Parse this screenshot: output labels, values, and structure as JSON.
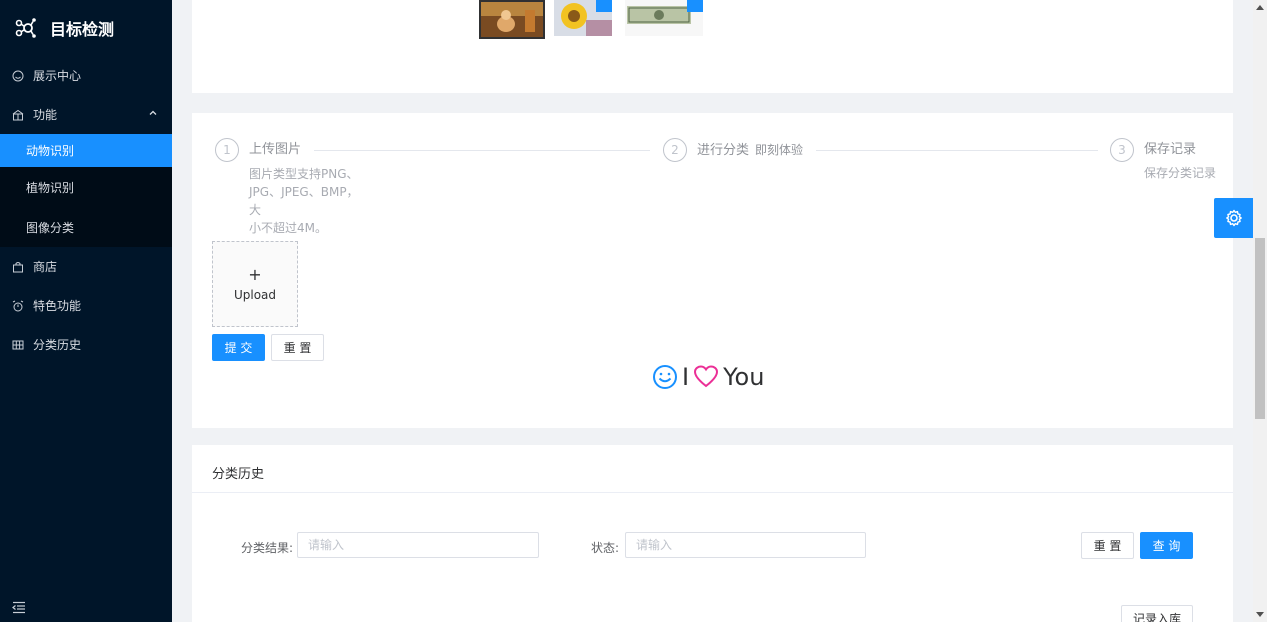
{
  "app": {
    "title": "目标检测"
  },
  "sidebar": {
    "items": [
      {
        "label": "展示中心",
        "icon": "smile-icon"
      },
      {
        "label": "功能",
        "icon": "gift-icon",
        "expanded": true,
        "children": [
          {
            "label": "动物识别",
            "active": true
          },
          {
            "label": "植物识别"
          },
          {
            "label": "图像分类"
          }
        ]
      },
      {
        "label": "商店",
        "icon": "shopping-bag-icon"
      },
      {
        "label": "特色功能",
        "icon": "alarm-icon"
      },
      {
        "label": "分类历史",
        "icon": "grid-icon"
      }
    ]
  },
  "steps": [
    {
      "num": "1",
      "title": "上传图片",
      "desc": [
        "图片类型支持PNG、",
        "JPG、JPEG、BMP，大",
        "小不超过4M。"
      ]
    },
    {
      "num": "2",
      "title": "进行分类",
      "sub": "即刻体验"
    },
    {
      "num": "3",
      "title": "保存记录",
      "desc": [
        "保存分类记录"
      ]
    }
  ],
  "upload": {
    "plus": "+",
    "label": "Upload"
  },
  "buttons": {
    "submit": "提 交",
    "reset": "重 置",
    "query": "查 询",
    "history_reset": "重 置",
    "record": "记录入库"
  },
  "love": {
    "i": "I",
    "you": "You"
  },
  "history": {
    "title": "分类历史",
    "result_label": "分类结果:",
    "result_placeholder": "请输入",
    "status_label": "状态:",
    "status_placeholder": "请输入"
  },
  "colors": {
    "primary": "#1890ff",
    "sidebar_bg": "#001529",
    "heart": "#eb2f96"
  }
}
